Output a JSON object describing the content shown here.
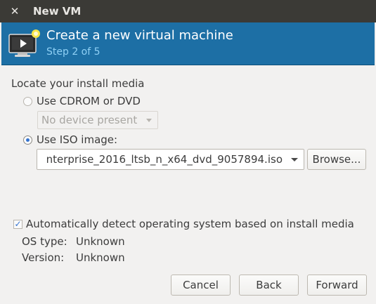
{
  "window": {
    "title": "New VM",
    "close_glyph": "✕"
  },
  "header": {
    "title": "Create a new virtual machine",
    "step": "Step 2 of 5",
    "icon": "monitor-play-icon",
    "accent_color": "#1d6fa5"
  },
  "install_media": {
    "section_label": "Locate your install media",
    "cdrom_label": "Use CDROM or DVD",
    "cdrom_selected": false,
    "cdrom_device_value": "No device present",
    "iso_label": "Use ISO image:",
    "iso_selected": true,
    "iso_path_value": "nterprise_2016_ltsb_n_x64_dvd_9057894.iso",
    "browse_label": "Browse..."
  },
  "os_detection": {
    "auto_detect_label": "Automatically detect operating system based on install media",
    "auto_detect_checked": true,
    "os_type_label": "OS type:",
    "os_type_value": "Unknown",
    "version_label": "Version:",
    "version_value": "Unknown"
  },
  "footer": {
    "cancel_label": "Cancel",
    "back_label": "Back",
    "forward_label": "Forward"
  }
}
